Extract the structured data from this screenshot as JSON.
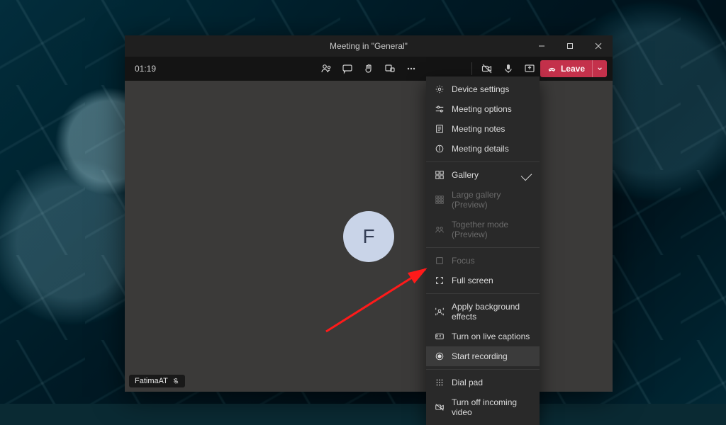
{
  "window": {
    "title": "Meeting in \"General\""
  },
  "toolbar": {
    "timer": "01:19",
    "leave_label": "Leave"
  },
  "avatar": {
    "initial": "F"
  },
  "participant_pill": {
    "name": "FatimaAT"
  },
  "menu": {
    "items": [
      {
        "label": "Device settings"
      },
      {
        "label": "Meeting options"
      },
      {
        "label": "Meeting notes"
      },
      {
        "label": "Meeting details"
      }
    ],
    "view_items": [
      {
        "label": "Gallery",
        "selected": true
      },
      {
        "label": "Large gallery (Preview)",
        "disabled": true
      },
      {
        "label": "Together mode (Preview)",
        "disabled": true
      }
    ],
    "view_items2": [
      {
        "label": "Focus",
        "disabled": true
      },
      {
        "label": "Full screen"
      }
    ],
    "action_items": [
      {
        "label": "Apply background effects"
      },
      {
        "label": "Turn on live captions"
      },
      {
        "label": "Start recording",
        "hover": true
      }
    ],
    "bottom_items": [
      {
        "label": "Dial pad"
      },
      {
        "label": "Turn off incoming video"
      }
    ]
  },
  "colors": {
    "leave_bg": "#c4314b",
    "menu_bg": "#292929",
    "body_bg": "#3b3a39"
  }
}
